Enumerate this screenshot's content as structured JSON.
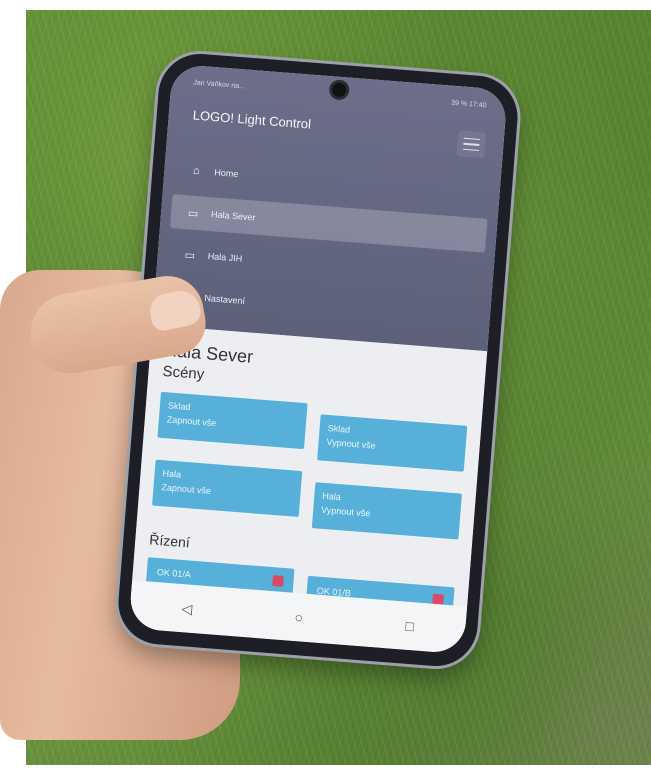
{
  "status_bar": {
    "left": "Jan Vaňkov na...",
    "right": "39 % 17:40"
  },
  "app": {
    "title": "LOGO! Light Control"
  },
  "nav": {
    "items": [
      {
        "label": "Home",
        "icon": "home-icon"
      },
      {
        "label": "Hala Sever",
        "icon": "laptop-icon",
        "active": true
      },
      {
        "label": "Hala JIH",
        "icon": "laptop-icon"
      },
      {
        "label": "Nastavení",
        "icon": "gear-icon"
      }
    ]
  },
  "page": {
    "title": "Hala Sever"
  },
  "scenes": {
    "title": "Scény",
    "buttons": [
      {
        "line1": "Sklad",
        "line2": "Zapnout vše"
      },
      {
        "line1": "Sklad",
        "line2": "Vypnout vše"
      },
      {
        "line1": "Hala",
        "line2": "Zapnout vše"
      },
      {
        "line1": "Hala",
        "line2": "Vypnout vše"
      }
    ]
  },
  "controls": {
    "title": "Řízení",
    "buttons": [
      {
        "label": "OK 01/A",
        "state_color": "#d94a6a"
      },
      {
        "label": "OK 01/B",
        "state_color": "#d94a6a"
      }
    ]
  },
  "system_nav": {
    "back": "◁",
    "home": "○",
    "recents": "□"
  },
  "colors": {
    "drawer_bg": "#5d6079",
    "button_bg": "#56b0d9",
    "state_off": "#d94a6a"
  }
}
